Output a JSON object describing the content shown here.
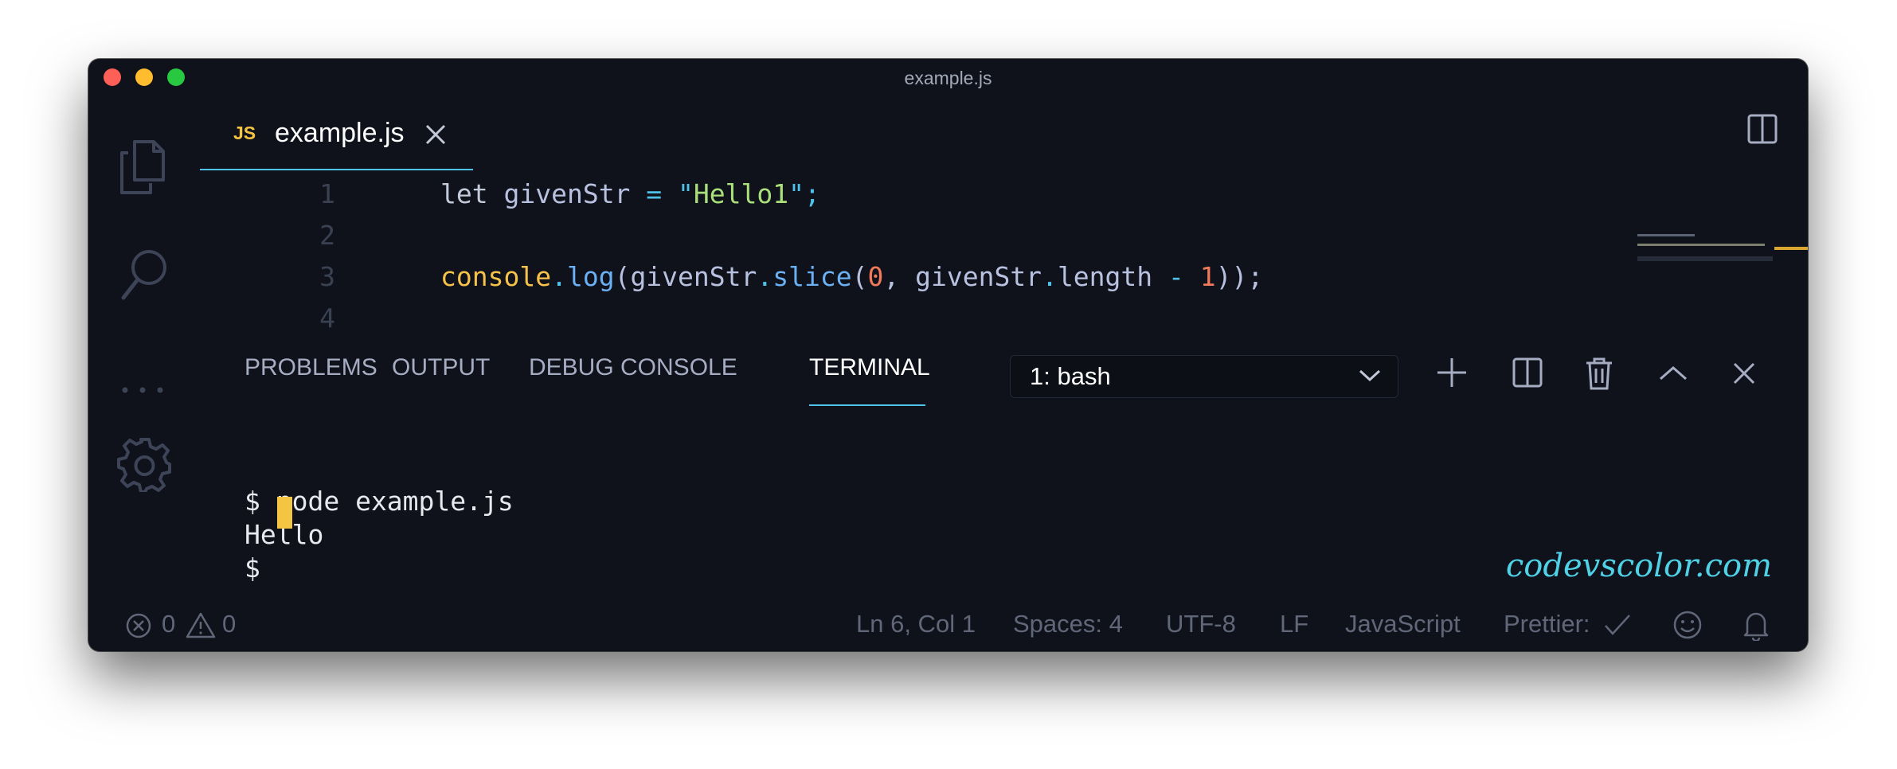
{
  "window": {
    "title": "example.js"
  },
  "tab": {
    "lang_badge": "JS",
    "filename": "example.js"
  },
  "editor": {
    "lines": [
      {
        "number": "1",
        "tokens": [
          {
            "t": "let ",
            "c": "kw"
          },
          {
            "t": "givenStr",
            "c": "var"
          },
          {
            "t": " = ",
            "c": "op"
          },
          {
            "t": "\"",
            "c": "quote"
          },
          {
            "t": "Hello1",
            "c": "str"
          },
          {
            "t": "\"",
            "c": "quote"
          },
          {
            "t": ";",
            "c": "op"
          }
        ]
      },
      {
        "number": "2",
        "tokens": []
      },
      {
        "number": "3",
        "tokens": [
          {
            "t": "console",
            "c": "obj"
          },
          {
            "t": ".",
            "c": "op"
          },
          {
            "t": "log",
            "c": "fn"
          },
          {
            "t": "(",
            "c": "var"
          },
          {
            "t": "givenStr",
            "c": "var"
          },
          {
            "t": ".",
            "c": "op"
          },
          {
            "t": "slice",
            "c": "fn"
          },
          {
            "t": "(",
            "c": "var"
          },
          {
            "t": "0",
            "c": "num"
          },
          {
            "t": ", ",
            "c": "var"
          },
          {
            "t": "givenStr",
            "c": "var"
          },
          {
            "t": ".",
            "c": "op"
          },
          {
            "t": "length",
            "c": "var"
          },
          {
            "t": " - ",
            "c": "op"
          },
          {
            "t": "1",
            "c": "num"
          },
          {
            "t": "));",
            "c": "var"
          }
        ]
      },
      {
        "number": "4",
        "tokens": []
      }
    ]
  },
  "panel": {
    "tabs": [
      "PROBLEMS",
      "OUTPUT",
      "DEBUG CONSOLE",
      "TERMINAL"
    ],
    "active_tab": "TERMINAL",
    "terminal_selector": "1: bash"
  },
  "terminal": {
    "lines": [
      "$ node example.js",
      "Hello",
      "$ "
    ]
  },
  "watermark": "codevscolor.com",
  "status": {
    "errors": "0",
    "warnings": "0",
    "position": "Ln 6, Col 1",
    "spaces": "Spaces: 4",
    "encoding": "UTF-8",
    "eol": "LF",
    "language": "JavaScript",
    "formatter": "Prettier:"
  },
  "colors": {
    "background": "#0f121b",
    "accent": "#4fc1e9",
    "cursor": "#f4c542"
  }
}
